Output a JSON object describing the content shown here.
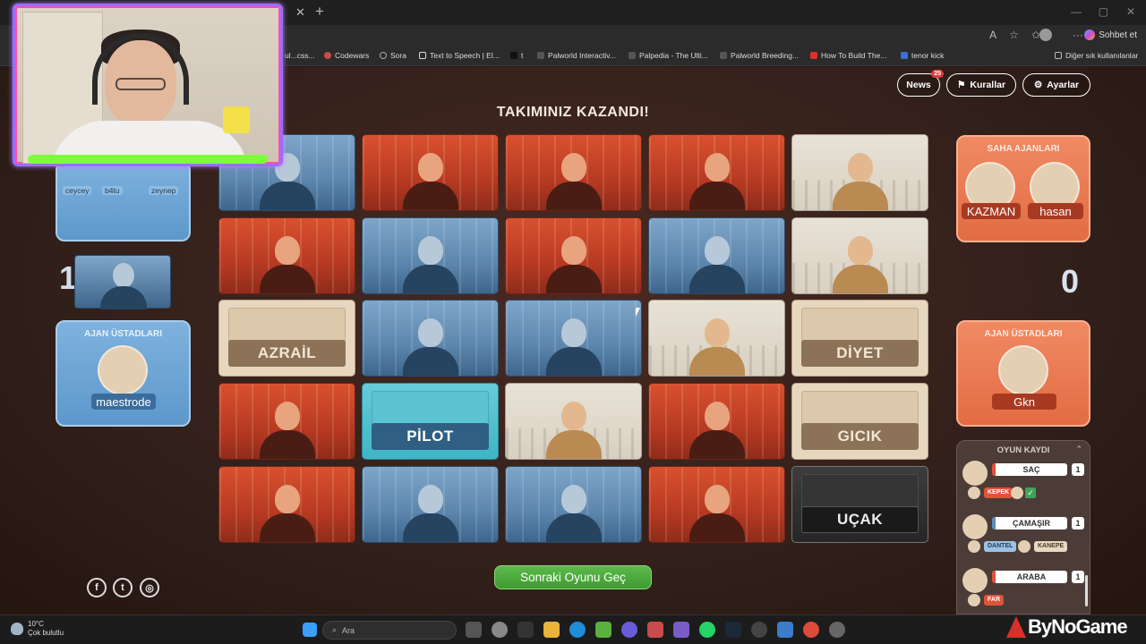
{
  "browser": {
    "bookmarks": [
      {
        "label": "ul...css...",
        "color": "#6a8cb2"
      },
      {
        "label": "Codewars",
        "color": "#c94b4b"
      },
      {
        "label": "Sora",
        "color": "#aaaaaa"
      },
      {
        "label": "Text to Speech | El...",
        "color": "#ffffff"
      },
      {
        "label": "t",
        "color": "#222222"
      },
      {
        "label": "Palworld Interactiv...",
        "color": "#333333"
      },
      {
        "label": "Palpedia - The Ulti...",
        "color": "#333333"
      },
      {
        "label": "Palworld Breeding...",
        "color": "#333333"
      },
      {
        "label": "How To Build The...",
        "color": "#e0302a"
      },
      {
        "label": "tenor kick",
        "color": "#3a6fd8"
      },
      {
        "label": "Diğer sık kullanılanlar",
        "color": "#bbbbbb"
      }
    ],
    "copilot_label": "Sohbet et"
  },
  "header": {
    "news_label": "News",
    "news_badge": "25",
    "rules_label": "Kurallar",
    "settings_label": "Ayarlar",
    "result_title": "TAKIMINIZ KAZANDI!"
  },
  "left_panel": {
    "operatives": [
      "ceycey",
      "b4tu",
      "zeynep"
    ],
    "score": "1",
    "spymasters_title": "AJAN ÜSTADLARI",
    "spymaster_name": "maestrode"
  },
  "right_panel": {
    "operatives_title": "SAHA AJANLARI",
    "operatives": [
      "KAZMAN",
      "hasan"
    ],
    "score": "0",
    "spymasters_title": "AJAN ÜSTADLARI",
    "spymaster_name": "Gkn"
  },
  "board": [
    {
      "type": "blue",
      "word": ""
    },
    {
      "type": "red",
      "word": ""
    },
    {
      "type": "red",
      "word": ""
    },
    {
      "type": "red",
      "word": ""
    },
    {
      "type": "neutral",
      "word": ""
    },
    {
      "type": "red",
      "word": ""
    },
    {
      "type": "blue",
      "word": ""
    },
    {
      "type": "red",
      "word": ""
    },
    {
      "type": "blue",
      "word": ""
    },
    {
      "type": "neutral",
      "word": ""
    },
    {
      "type": "cream",
      "word": "AZRAİL"
    },
    {
      "type": "blue",
      "word": ""
    },
    {
      "type": "blue",
      "word": ""
    },
    {
      "type": "neutral",
      "word": ""
    },
    {
      "type": "cream",
      "word": "DİYET"
    },
    {
      "type": "red",
      "word": ""
    },
    {
      "type": "teal",
      "word": "PİLOT"
    },
    {
      "type": "neutral",
      "word": ""
    },
    {
      "type": "red",
      "word": ""
    },
    {
      "type": "cream",
      "word": "GICIK"
    },
    {
      "type": "red",
      "word": ""
    },
    {
      "type": "blue",
      "word": ""
    },
    {
      "type": "blue",
      "word": ""
    },
    {
      "type": "red",
      "word": ""
    },
    {
      "type": "assassin",
      "word": "UÇAK"
    }
  ],
  "log": {
    "title": "OYUN KAYDI",
    "entries": [
      {
        "author": "Gkn",
        "clue": "SAÇ",
        "number": "1",
        "team": "red",
        "guesses": [
          {
            "word": "KEPEK",
            "team": "red"
          }
        ]
      },
      {
        "author": "maestrode",
        "clue": "ÇAMAŞIR",
        "number": "1",
        "team": "blue",
        "guesses": [
          {
            "word": "DANTEL",
            "team": "blue"
          },
          {
            "word": "KANEPE",
            "team": "cream"
          }
        ]
      },
      {
        "author": "Gkn",
        "clue": "ARABA",
        "number": "1",
        "team": "red",
        "guesses": [
          {
            "word": "FAR",
            "team": "red"
          }
        ]
      }
    ]
  },
  "next_button_label": "Sonraki Oyunu Geç",
  "taskbar": {
    "temperature": "10°C",
    "weather": "Çok bulutlu",
    "search_placeholder": "Ara"
  },
  "watermark": "ByNoGame"
}
